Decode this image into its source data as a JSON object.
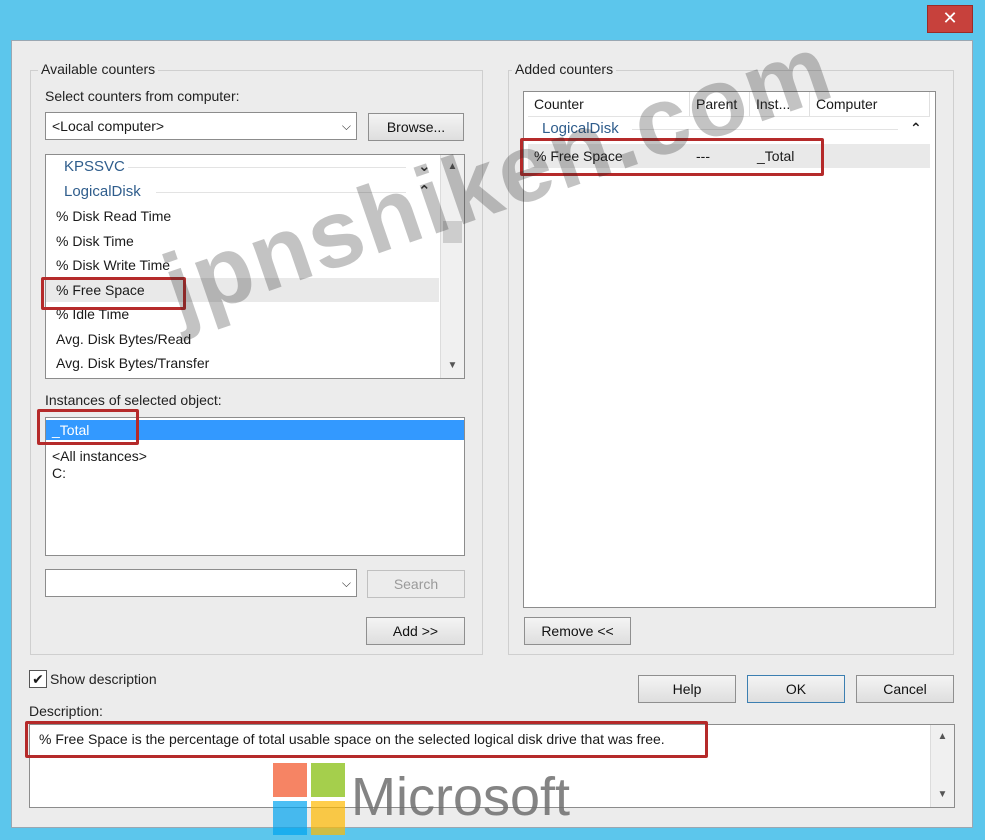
{
  "window": {
    "close_symbol": "✕"
  },
  "available": {
    "group_label": "Available counters",
    "select_label": "Select counters from computer:",
    "computer_value": "<Local computer>",
    "browse_label": "Browse...",
    "counters": [
      {
        "label": "KPSSVC",
        "type": "group",
        "chevron": "⌄"
      },
      {
        "label": "LogicalDisk",
        "type": "group",
        "chevron": "⌃"
      },
      {
        "label": "% Disk Read Time",
        "type": "item"
      },
      {
        "label": "% Disk Time",
        "type": "item"
      },
      {
        "label": "% Disk Write Time",
        "type": "item"
      },
      {
        "label": "% Free Space",
        "type": "item",
        "selected": true
      },
      {
        "label": "% Idle Time",
        "type": "item"
      },
      {
        "label": "Avg. Disk Bytes/Read",
        "type": "item"
      },
      {
        "label": "Avg. Disk Bytes/Transfer",
        "type": "item"
      }
    ],
    "instances_label": "Instances of selected object:",
    "instances": [
      "_Total",
      "<All instances>",
      "C:"
    ],
    "search_value": "",
    "search_label": "Search",
    "add_label": "Add >>"
  },
  "added": {
    "group_label": "Added counters",
    "columns": [
      "Counter",
      "Parent",
      "Inst...",
      "Computer"
    ],
    "group_name": "LogicalDisk",
    "group_chevron": "⌃",
    "rows": [
      {
        "counter": "% Free Space",
        "parent": "---",
        "instance": "_Total",
        "computer": ""
      }
    ],
    "remove_label": "Remove <<"
  },
  "show_description": {
    "label": "Show description",
    "checked": true,
    "check_glyph": "✔"
  },
  "buttons": {
    "help": "Help",
    "ok": "OK",
    "cancel": "Cancel"
  },
  "description": {
    "label": "Description:",
    "text": "% Free Space is the percentage of total usable space on the selected logical disk drive that was free."
  },
  "watermark": "jpnshiken.com",
  "branding": {
    "logo_text": "Microsoft",
    "logo_colors": [
      "#f25022",
      "#7fba00",
      "#00a4ef",
      "#ffb900"
    ]
  },
  "colors": {
    "selection": "#3399ff",
    "highlight_row": "#e9e9e9",
    "annotation": "#b52a2a",
    "title_bar": "#5cc6ec"
  }
}
